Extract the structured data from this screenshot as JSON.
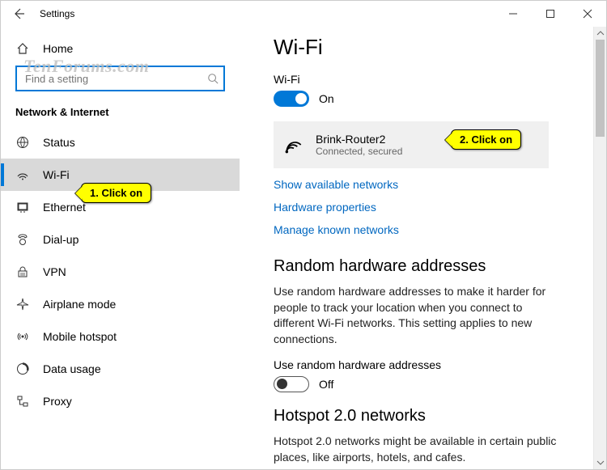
{
  "window": {
    "title": "Settings"
  },
  "watermark": "TenForums.com",
  "sidebar": {
    "home": "Home",
    "search_placeholder": "Find a setting",
    "section": "Network & Internet",
    "items": [
      {
        "label": "Status"
      },
      {
        "label": "Wi-Fi"
      },
      {
        "label": "Ethernet"
      },
      {
        "label": "Dial-up"
      },
      {
        "label": "VPN"
      },
      {
        "label": "Airplane mode"
      },
      {
        "label": "Mobile hotspot"
      },
      {
        "label": "Data usage"
      },
      {
        "label": "Proxy"
      }
    ]
  },
  "main": {
    "title": "Wi-Fi",
    "wifi_label": "Wi-Fi",
    "wifi_state": "On",
    "network": {
      "name": "Brink-Router2",
      "status": "Connected, secured"
    },
    "links": {
      "show": "Show available networks",
      "hw": "Hardware properties",
      "manage": "Manage known networks"
    },
    "random": {
      "heading": "Random hardware addresses",
      "body": "Use random hardware addresses to make it harder for people to track your location when you connect to different Wi-Fi networks. This setting applies to new connections.",
      "toggle_label": "Use random hardware addresses",
      "toggle_state": "Off"
    },
    "hotspot": {
      "heading": "Hotspot 2.0 networks",
      "body": "Hotspot 2.0 networks might be available in certain public places, like airports, hotels, and cafes."
    }
  },
  "callouts": {
    "one": "1. Click on",
    "two": "2. Click on"
  }
}
